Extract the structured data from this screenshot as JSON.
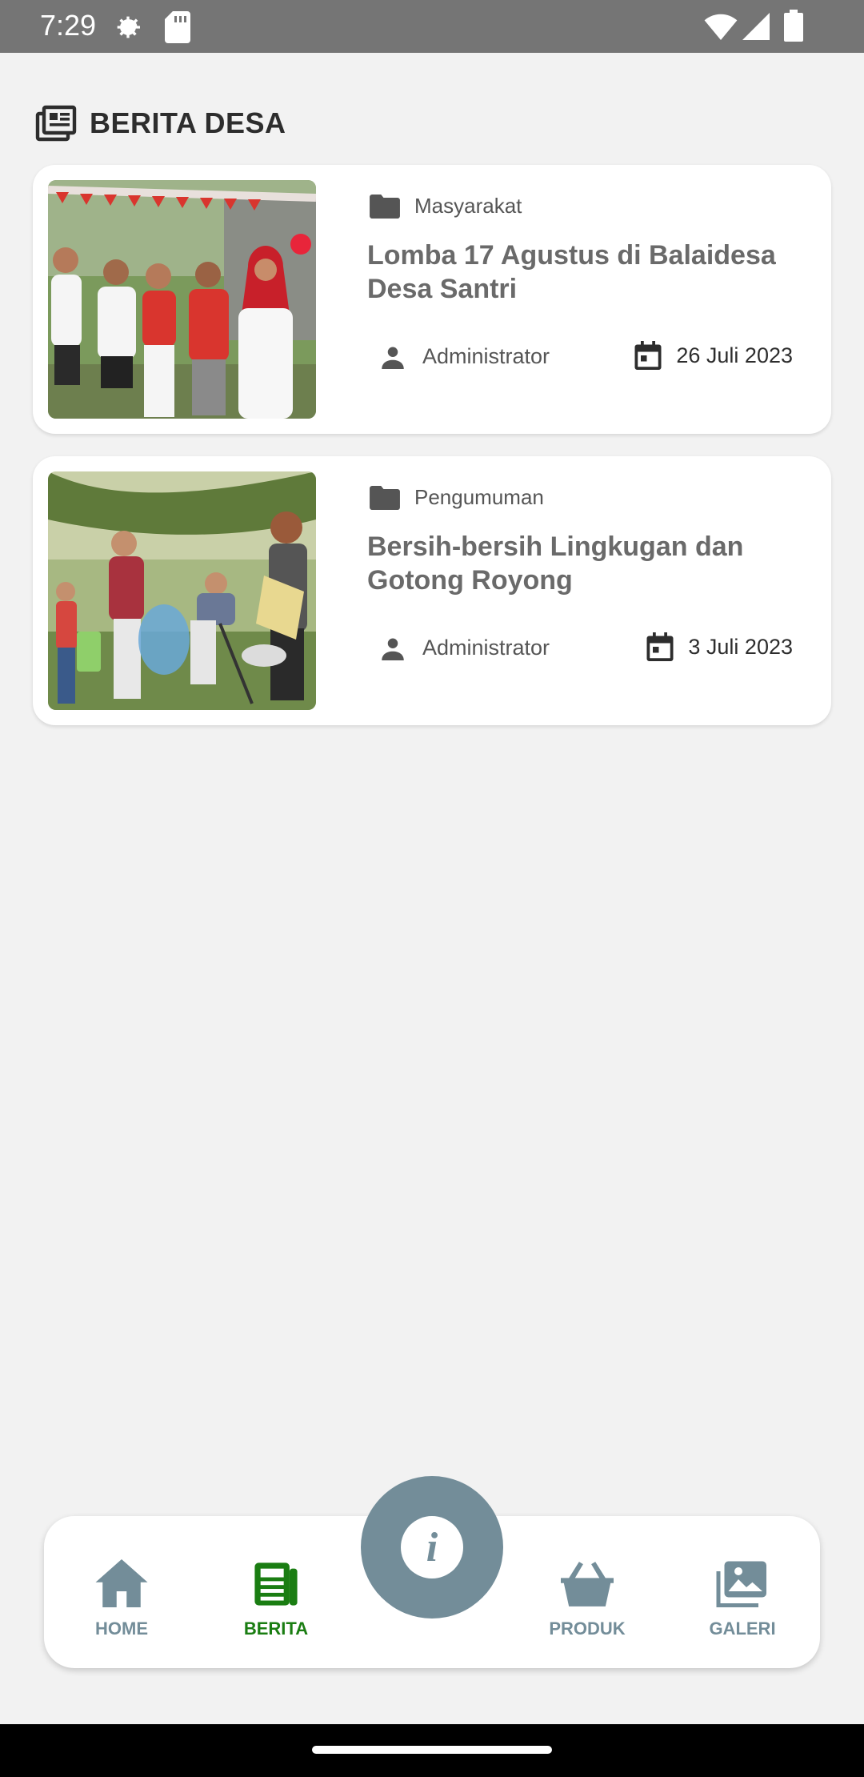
{
  "status_bar": {
    "time": "7:29",
    "icons": [
      "settings-icon",
      "sd-card-icon",
      "wifi-icon",
      "signal-icon",
      "battery-icon"
    ]
  },
  "header": {
    "icon": "news-list-icon",
    "title": "BERITA DESA"
  },
  "news": [
    {
      "category": "Masyarakat",
      "title": "Lomba 17 Agustus di Balaidesa Desa Santri",
      "author": "Administrator",
      "date": "26 Juli 2023"
    },
    {
      "category": "Pengumuman",
      "title": "Bersih-bersih Lingkugan dan Gotong Royong",
      "author": "Administrator",
      "date": "3 Juli 2023"
    }
  ],
  "bottom_nav": {
    "items": [
      {
        "label": "HOME",
        "icon": "home-icon"
      },
      {
        "label": "BERITA",
        "icon": "news-icon",
        "active": true
      },
      {
        "label": "PRODUK",
        "icon": "basket-icon"
      },
      {
        "label": "GALERI",
        "icon": "gallery-icon"
      }
    ],
    "center_button": {
      "glyph": "i",
      "icon": "info-icon"
    }
  },
  "colors": {
    "accent_active": "#1a7d12",
    "nav_inactive": "#738d99",
    "background": "#f2f2f2",
    "status_bar": "#757575"
  }
}
